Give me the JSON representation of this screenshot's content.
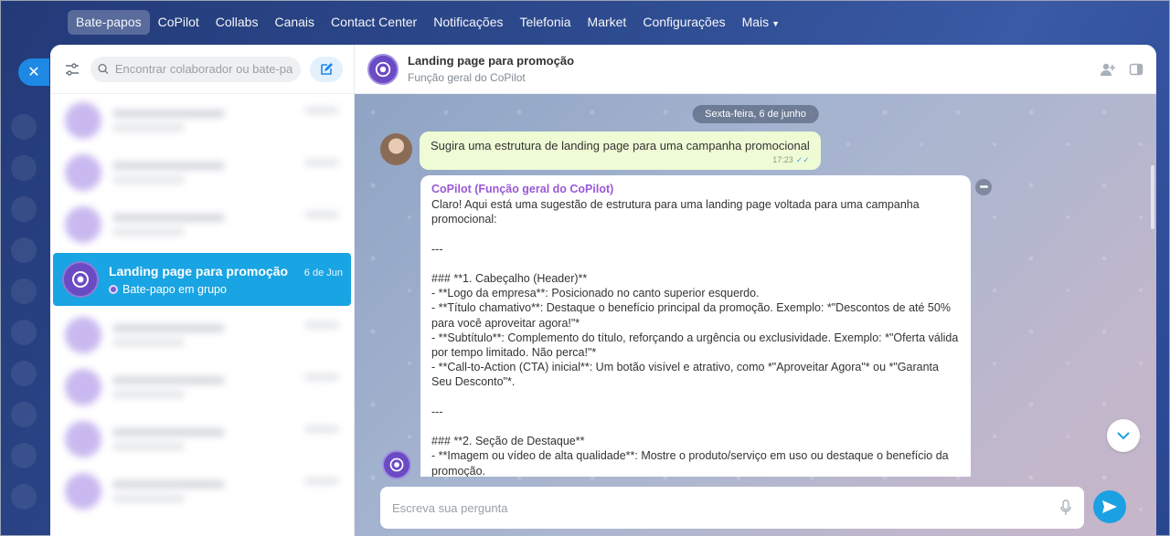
{
  "topnav": {
    "items": [
      "Bate-papos",
      "CoPilot",
      "Collabs",
      "Canais",
      "Contact Center",
      "Notificações",
      "Telefonia",
      "Market",
      "Configurações"
    ],
    "more": "Mais"
  },
  "sidebar": {
    "search_placeholder": "Encontrar colaborador ou bate-papo",
    "active_chat": {
      "title": "Landing page para promoção",
      "date": "6 de Jun",
      "subtitle": "Bate-papo em grupo"
    }
  },
  "chat": {
    "title": "Landing page para promoção",
    "subtitle": "Função geral do CoPilot",
    "date_divider": "Sexta-feira, 6 de junho",
    "user_message": {
      "text": "Sugira uma estrutura de landing page para uma campanha promocional",
      "time": "17:23"
    },
    "bot_message": {
      "author": "CoPilot (Função geral do CoPilot)",
      "lines": [
        "Claro! Aqui está uma sugestão de estrutura para uma landing page voltada para uma campanha promocional:",
        "",
        "---",
        "",
        "### **1. Cabeçalho (Header)**",
        "- **Logo da empresa**: Posicionado no canto superior esquerdo.",
        "- **Título chamativo**: Destaque o benefício principal da promoção. Exemplo: *\"Descontos de até 50% para você aproveitar agora!\"*",
        "- **Subtítulo**: Complemento do título, reforçando a urgência ou exclusividade. Exemplo: *\"Oferta válida por tempo limitado. Não perca!\"*",
        "- **Call-to-Action (CTA) inicial**: Um botão visível e atrativo, como *\"Aproveitar Agora\"* ou *\"Garanta Seu Desconto\"*.",
        "",
        "---",
        "",
        "### **2. Seção de Destaque**",
        "- **Imagem ou vídeo de alta qualidade**: Mostre o produto/serviço em uso ou destaque o benefício da promoção."
      ]
    },
    "composer_placeholder": "Escreva sua pergunta"
  }
}
